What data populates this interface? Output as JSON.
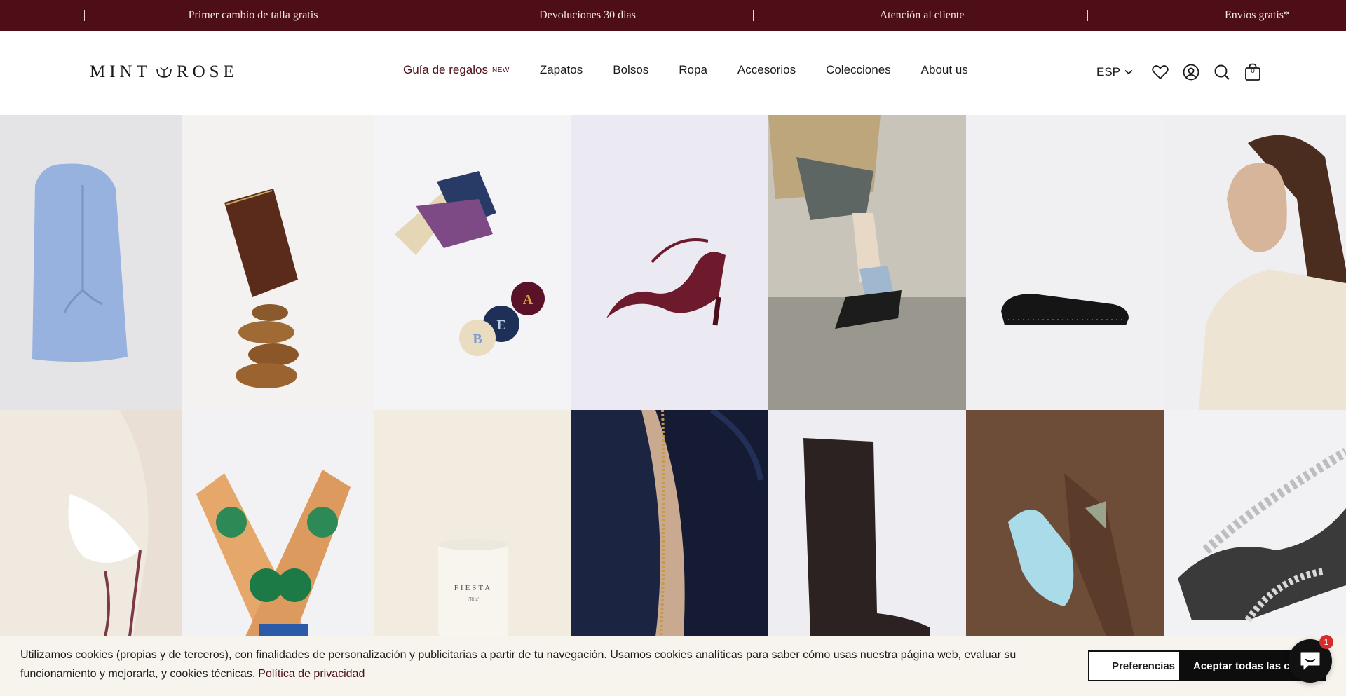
{
  "announcement": {
    "messages": [
      "Primer cambio de talla gratis",
      "Devoluciones 30 días",
      "Atención al cliente",
      "Envíos gratis*"
    ]
  },
  "header": {
    "logo_text": "MINT&ROSE",
    "nav": [
      {
        "label": "Guía de regalos",
        "badge": "NEW"
      },
      {
        "label": "Zapatos"
      },
      {
        "label": "Bolsos"
      },
      {
        "label": "Ropa"
      },
      {
        "label": "Accesorios"
      },
      {
        "label": "Colecciones"
      },
      {
        "label": "About us"
      }
    ],
    "currency": "ESP",
    "cart_count": "0",
    "icons": [
      "wishlist-heart-icon",
      "account-icon",
      "search-icon",
      "cart-bag-icon"
    ]
  },
  "grid": {
    "tiles": [
      "knit-balaclava",
      "brown-leather-pouch",
      "keychain-tassels",
      "burgundy-heel-sandal",
      "blue-socks-slingback",
      "black-studded-loafer",
      "woman-cream-polo",
      "cream-scarf",
      "printed-socks",
      "fiesta-candle",
      "navy-zip-bag",
      "brown-tall-boot",
      "light-blue-glove",
      "snake-print-sandal"
    ],
    "candle_label": "FIESTA",
    "candle_sublabel": "l'Ritz'",
    "keychain_letters": [
      "A",
      "E",
      "B"
    ]
  },
  "cookie": {
    "text": "Utilizamos cookies (propias y de terceros), con finalidades de personalización y publicitarias a partir de tu navegación. Usamos cookies analíticas para saber cómo usas nuestra página web, evaluar su funcionamiento y mejorarla, y cookies técnicas.",
    "link": "Política de privacidad",
    "preferences": "Preferencias",
    "accept": "Aceptar todas las cookies"
  },
  "chat": {
    "badge": "1"
  },
  "colors": {
    "brand": "#4e0e17",
    "banner_bg": "#f6f4ec",
    "button": "#0d0d0d"
  }
}
